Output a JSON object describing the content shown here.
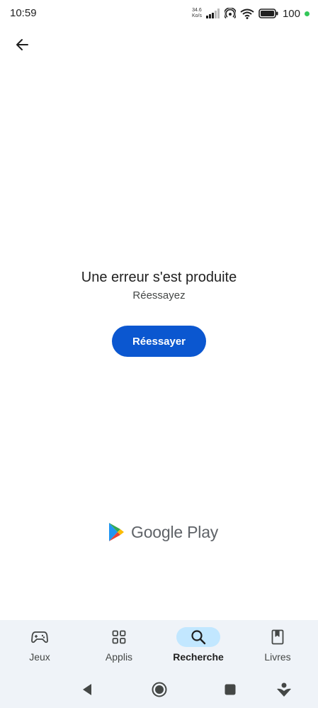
{
  "status_bar": {
    "time": "10:59",
    "net_speed_value": "34.6",
    "net_speed_unit": "Ko/s",
    "battery_level": "100",
    "icons": [
      "signal-icon",
      "hotspot-icon",
      "wifi-icon",
      "battery-icon"
    ]
  },
  "top_bar": {
    "back_icon": "arrow-back-icon"
  },
  "error": {
    "title": "Une erreur s'est produite",
    "subtitle": "Réessayez",
    "retry_label": "Réessayer"
  },
  "logo": {
    "text": "Google Play"
  },
  "bottom_nav": {
    "items": [
      {
        "label": "Jeux",
        "icon": "gamepad-icon",
        "active": false
      },
      {
        "label": "Applis",
        "icon": "apps-grid-icon",
        "active": false
      },
      {
        "label": "Recherche",
        "icon": "search-icon",
        "active": true
      },
      {
        "label": "Livres",
        "icon": "book-icon",
        "active": false
      }
    ]
  },
  "system_nav": {
    "icons": [
      "back-triangle-icon",
      "home-circle-icon",
      "recents-square-icon",
      "assistant-icon"
    ]
  },
  "colors": {
    "accent": "#0b57d0",
    "active_pill": "#c2e7ff",
    "nav_background": "#eff3f8",
    "status_dot": "#34c759"
  }
}
